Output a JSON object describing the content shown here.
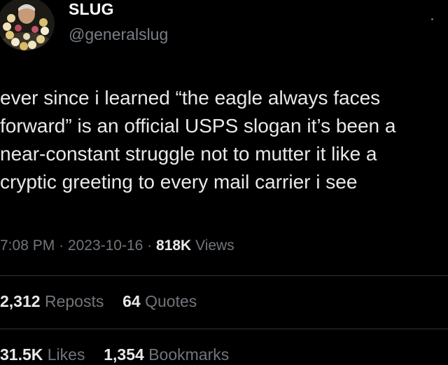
{
  "author": {
    "display_name": "SLUG",
    "handle": "@generalslug",
    "avatar_icon": "profile-photo-with-flower-lei"
  },
  "tweet": {
    "lines": [
      "ever since i learned “the eagle always faces",
      "forward” is an official USPS slogan it’s been a",
      "near-constant struggle not to mutter it like a",
      "cryptic greeting to every mail carrier i see"
    ]
  },
  "meta": {
    "time": "7:08 PM",
    "sep1": "·",
    "date": "2023-10-16",
    "sep2": "·",
    "views_count": "818K",
    "views_label": "Views"
  },
  "stats": {
    "reposts_count": "2,312",
    "reposts_label": "Reposts",
    "quotes_count": "64",
    "quotes_label": "Quotes",
    "likes_count": "31.5K",
    "likes_label": "Likes",
    "bookmarks_count": "1,354",
    "bookmarks_label": "Bookmarks"
  },
  "colors": {
    "background": "#000000",
    "text": "#e7e9ea",
    "muted": "#71767b",
    "divider": "#2f3336"
  }
}
